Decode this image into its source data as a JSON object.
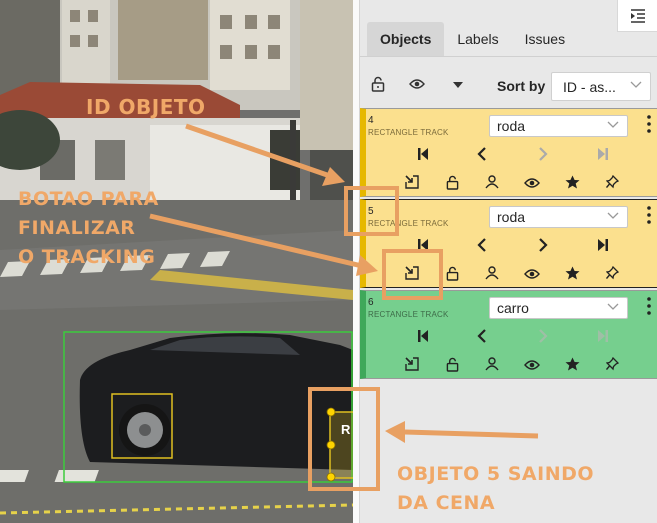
{
  "sidebar": {
    "tabs": [
      {
        "label": "Objects",
        "active": true
      },
      {
        "label": "Labels",
        "active": false
      },
      {
        "label": "Issues",
        "active": false
      }
    ],
    "toolbar": {
      "lock_icon": "unlock-icon",
      "eye_icon": "eye-icon",
      "caret_icon": "caret-down-icon",
      "sort_label": "Sort by",
      "sort_value": "ID - as..."
    },
    "collapse_icon": "collapse-sidebar-icon"
  },
  "objects": [
    {
      "id": "4",
      "type": "RECTANGLE TRACK",
      "label": "roda",
      "color": "#fbe08e"
    },
    {
      "id": "5",
      "type": "RECTANGLE TRACK",
      "label": "roda",
      "color": "#fbe08e"
    },
    {
      "id": "6",
      "type": "RECTANGLE TRACK",
      "label": "carro",
      "color": "#76cf8e"
    }
  ],
  "card_icons": {
    "nav": [
      "first-frame-icon",
      "previous-frame-icon",
      "next-frame-icon",
      "last-frame-icon"
    ],
    "actions": [
      "finish-tracking-icon",
      "unlock-icon",
      "person-icon",
      "eye-icon",
      "star-icon",
      "pin-icon"
    ]
  },
  "canvas": {
    "partial_label": "R"
  },
  "annotations": {
    "id_objeto": "ID OBJETO",
    "botao_line1": "BOTAO PARA",
    "botao_line2": "FINALIZAR",
    "botao_line3": "O TRACKING",
    "saindo_line1": "OBJETO 5 SAINDO",
    "saindo_line2": "DA CENA",
    "color": "#f0a868"
  }
}
